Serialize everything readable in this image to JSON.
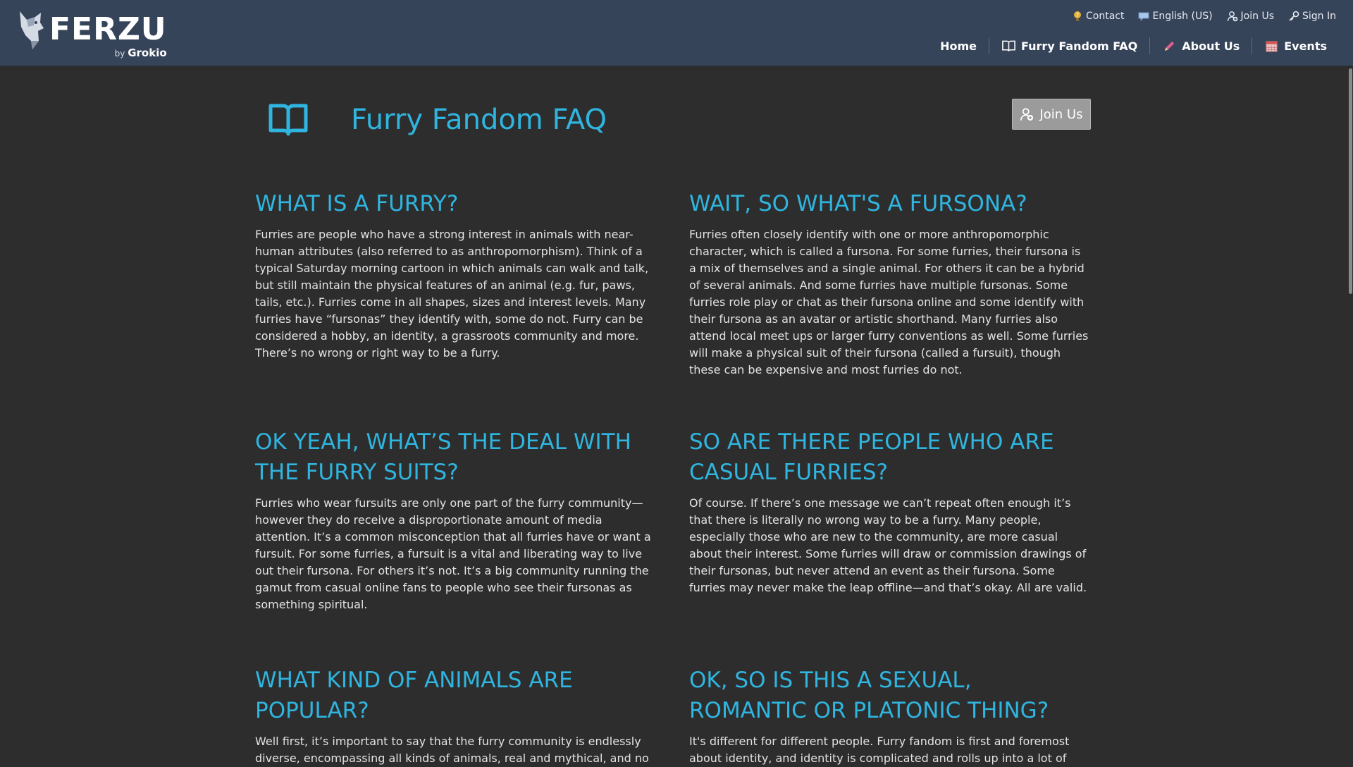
{
  "header": {
    "logo": {
      "word": "FERZU",
      "by": "by",
      "brand": "Grokio"
    },
    "utility": [
      {
        "label": "Contact",
        "icon": "question-bulb-icon"
      },
      {
        "label": "English (US)",
        "icon": "speech-bubble-icon"
      },
      {
        "label": "Join Us",
        "icon": "add-user-icon"
      },
      {
        "label": "Sign In",
        "icon": "key-icon"
      }
    ],
    "nav": [
      {
        "label": "Home"
      },
      {
        "label": "Furry Fandom FAQ",
        "icon": "book-icon"
      },
      {
        "label": "About Us",
        "icon": "pencil-icon"
      },
      {
        "label": "Events",
        "icon": "calendar-icon"
      }
    ]
  },
  "page": {
    "title": "Furry Fandom FAQ",
    "join_button": "Join Us"
  },
  "faq": [
    {
      "question": "WHAT IS A FURRY?",
      "answer": "Furries are people who have a strong interest in animals with near-human attributes (also referred to as anthropomorphism). Think of a typical Saturday morning cartoon in which animals can walk and talk, but still maintain the physical features of an animal (e.g. fur, paws, tails, etc.). Furries come in all shapes, sizes and interest levels. Many furries have “fursonas” they identify with, some do not. Furry can be considered a hobby, an identity, a grassroots community and more. There’s no wrong or right way to be a furry."
    },
    {
      "question": "WAIT, SO WHAT'S A FURSONA?",
      "answer": "Furries often closely identify with one or more anthropomorphic character, which is called a fursona. For some furries, their fursona is a mix of themselves and a single animal. For others it can be a hybrid of several animals. And some furries have multiple fursonas. Some furries role play or chat as their fursona online and some identify with their fursona as an avatar or artistic shorthand. Many furries also attend local meet ups or larger furry conventions as well. Some furries will make a physical suit of their fursona (called a fursuit), though these can be expensive and most furries do not."
    },
    {
      "question": "OK YEAH, WHAT’S THE DEAL WITH THE FURRY SUITS?",
      "answer": "Furries who wear fursuits are only one part of the furry community—however they do receive a disproportionate amount of media attention. It’s a common misconception that all furries have or want a fursuit. For some furries, a fursuit is a vital and liberating way to live out their fursona. For others it’s not. It’s a big community running the gamut from casual online fans to people who see their fursonas as something spiritual."
    },
    {
      "question": "SO ARE THERE PEOPLE WHO ARE CASUAL FURRIES?",
      "answer": "Of course. If there’s one message we can’t repeat often enough it’s that there is literally no wrong way to be a furry. Many people, especially those who are new to the community, are more casual about their interest. Some furries will draw or commission drawings of their fursonas, but never attend an event as their fursona. Some furries may never make the leap offline—and that’s okay. All are valid."
    },
    {
      "question": "WHAT KIND OF ANIMALS ARE POPULAR?",
      "answer": "Well first, it’s important to say that the furry community is endlessly diverse, encompassing all kinds of animals, real and mythical, and no"
    },
    {
      "question": "OK, SO IS THIS A SEXUAL, ROMANTIC OR PLATONIC THING?",
      "answer": "It's different for different people. Furry fandom is first and foremost about identity, and identity is complicated and rolls up into a lot of"
    }
  ],
  "colors": {
    "header_bg": "#36445a",
    "page_bg": "#2d2d2d",
    "accent": "#2fb5df",
    "button_bg": "#9b9b9b"
  }
}
